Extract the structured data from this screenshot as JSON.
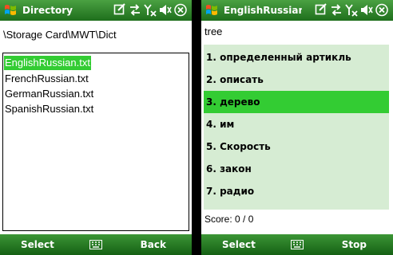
{
  "left": {
    "title": "Directory",
    "path": "\\Storage Card\\MWT\\Dict",
    "files": [
      "EnglishRussian.txt",
      "FrenchRussian.txt",
      "GermanRussian.txt",
      "SpanishRussian.txt"
    ],
    "selected_index": 0,
    "softkeys": {
      "left": "Select",
      "right": "Back"
    }
  },
  "right": {
    "title": "EnglishRussian.tx",
    "word": "tree",
    "options": [
      "1. определенный артикль",
      "2. описать",
      "3. дерево",
      "4. им",
      "5. Скорость",
      "6. закон",
      "7. радио"
    ],
    "selected_index": 2,
    "score": "Score: 0 / 0",
    "softkeys": {
      "left": "Select",
      "right": "Stop"
    }
  },
  "status_icons": [
    "edit-icon",
    "sync-icon",
    "no-signal-icon",
    "speaker-icon",
    "close-icon"
  ],
  "colors": {
    "title_green": "#2e8a2a",
    "selection": "#33cc33",
    "quiz_bg": "#d6ecd3"
  }
}
